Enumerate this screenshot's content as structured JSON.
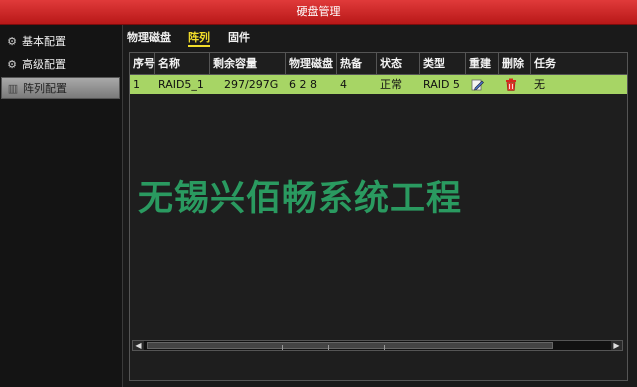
{
  "window": {
    "title": "硬盘管理"
  },
  "sidebar": {
    "items": [
      {
        "label": "基本配置",
        "active": false
      },
      {
        "label": "高级配置",
        "active": false
      },
      {
        "label": "阵列配置",
        "active": true
      }
    ]
  },
  "tabs": [
    {
      "label": "物理磁盘",
      "active": false
    },
    {
      "label": "阵列",
      "active": true
    },
    {
      "label": "固件",
      "active": false
    }
  ],
  "table": {
    "columns": [
      "序号",
      "名称",
      "剩余容量",
      "物理磁盘",
      "热备",
      "状态",
      "类型",
      "重建",
      "删除",
      "任务"
    ],
    "rows": [
      {
        "index": "1",
        "name": "RAID5_1",
        "free": "297/297G",
        "disks": "6 2 8",
        "hotspare": "4",
        "status": "正常",
        "type": "RAID 5",
        "rebuild_icon": "edit-icon",
        "delete_icon": "trash-icon",
        "task": "无",
        "highlighted": true
      }
    ]
  },
  "watermark": "无锡兴佰畅系统工程",
  "colors": {
    "title_bar": "#c8201f",
    "selected_row": "#a7d565",
    "active_tab": "#f2dd2a",
    "watermark": "#2a9a60"
  }
}
